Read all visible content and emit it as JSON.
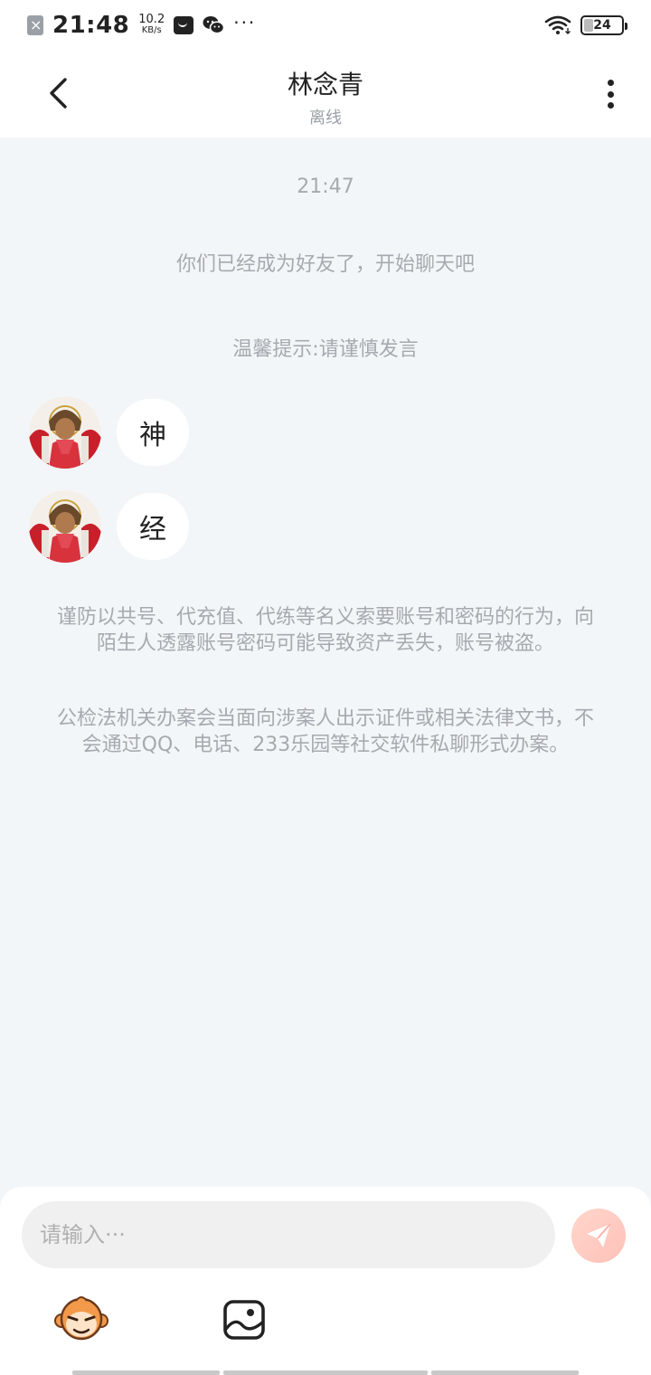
{
  "status_bar": {
    "time": "21:48",
    "net_speed_value": "10.2",
    "net_speed_unit": "KB/s",
    "battery": "24"
  },
  "header": {
    "name": "林念青",
    "status": "离线"
  },
  "chat": {
    "timestamp": "21:47",
    "friend_notice": "你们已经成为好友了，开始聊天吧",
    "tip": "温馨提示:请谨慎发言",
    "messages": [
      {
        "text": "神"
      },
      {
        "text": "经"
      }
    ],
    "warning_1": "谨防以共号、代充值、代练等名义索要账号和密码的行为，向陌生人透露账号密码可能导致资产丢失，账号被盗。",
    "warning_2": "公检法机关办案会当面向涉案人出示证件或相关法律文书，不会通过QQ、电话、233乐园等社交软件私聊形式办案。"
  },
  "input": {
    "placeholder": "请输入···"
  },
  "colors": {
    "chat_background": "#f3f6f8",
    "send_button": "#ffc9c0",
    "muted_text": "#a6aab0"
  }
}
